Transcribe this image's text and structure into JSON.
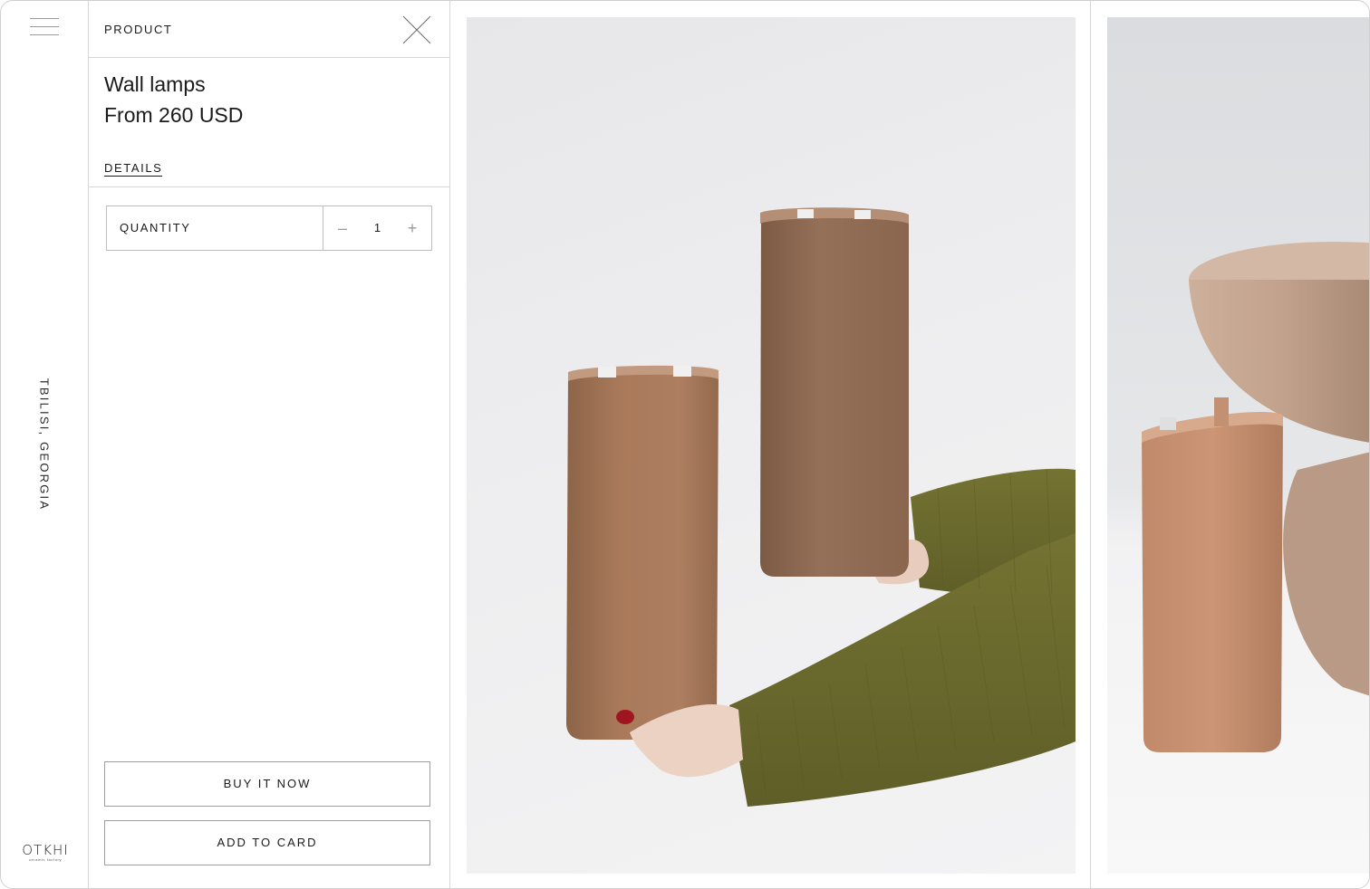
{
  "sidebar": {
    "menu_icon": "hamburger-menu-icon",
    "location": "TBILISI, GEORGIA",
    "logo": {
      "mark": "OTKHI",
      "subtitle": "ceramic factory"
    }
  },
  "panel": {
    "title": "PRODUCT",
    "close_icon": "close-icon",
    "product_name": "Wall lamps",
    "price": "From 260 USD",
    "details_label": "DETAILS",
    "quantity": {
      "label": "QUANTITY",
      "value": "1",
      "decrement_symbol": "–",
      "increment_symbol": "+"
    },
    "buy_now_label": "BUY IT NOW",
    "add_to_cart_label": "ADD TO CARD"
  },
  "gallery": {
    "images": [
      {
        "description_icon": "product-photo",
        "subject": "two ceramic wall lamps held by hands"
      },
      {
        "description_icon": "product-photo",
        "subject": "ceramic wall lamp beside stone stool"
      }
    ]
  },
  "colors": {
    "border": "#d6d6d6",
    "text": "#1a1a1a",
    "clay": "#a97a5c",
    "sweater": "#6b6a2e"
  }
}
